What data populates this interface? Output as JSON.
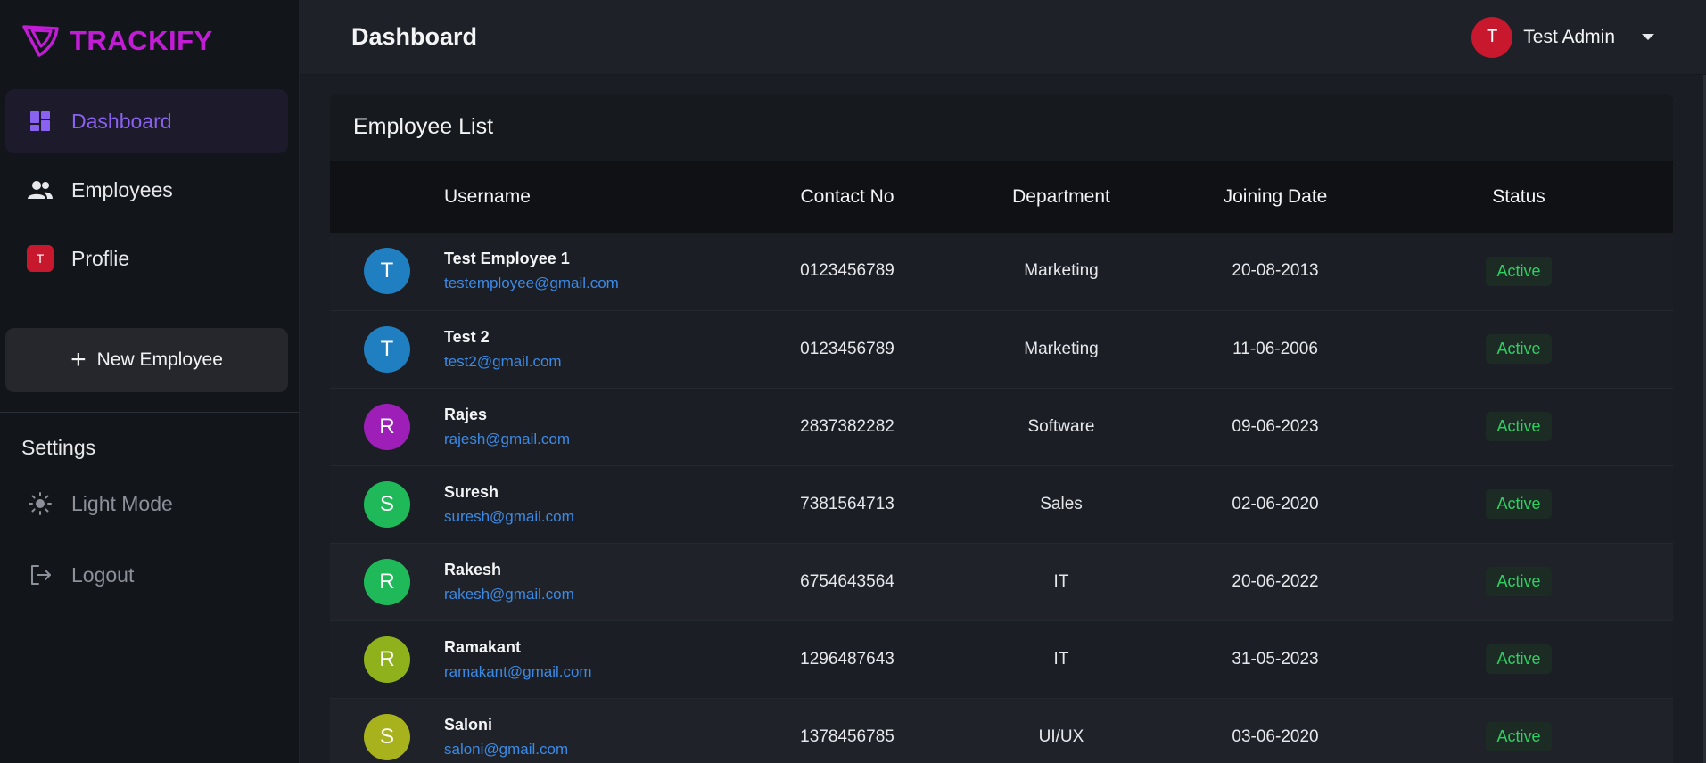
{
  "brand": {
    "name": "TRACKIFY",
    "color": "#c21cd6",
    "logo_icon": "trackify-logo-icon"
  },
  "sidebar": {
    "nav": [
      {
        "label": "Dashboard",
        "icon": "dashboard-icon",
        "active": true
      },
      {
        "label": "Employees",
        "icon": "people-icon",
        "active": false
      },
      {
        "label": "Proflie",
        "icon": "profile-badge-icon",
        "badge": "T",
        "active": false
      }
    ],
    "new_button": {
      "label": "New Employee",
      "icon": "plus-icon"
    },
    "settings": {
      "heading": "Settings",
      "items": [
        {
          "label": "Light Mode",
          "icon": "sun-icon"
        },
        {
          "label": "Logout",
          "icon": "logout-icon"
        }
      ]
    }
  },
  "header": {
    "title": "Dashboard",
    "user": {
      "initial": "T",
      "name": "Test Admin",
      "avatar_color": "#c8182d"
    }
  },
  "employee_list": {
    "title": "Employee List",
    "columns": [
      "Username",
      "Contact No",
      "Department",
      "Joining Date",
      "Status"
    ],
    "rows": [
      {
        "initial": "T",
        "avatar_color": "#1f7fc0",
        "name": "Test Employee 1",
        "email": "testemployee@gmail.com",
        "contact": "0123456789",
        "department": "Marketing",
        "joining": "20-08-2013",
        "status": "Active"
      },
      {
        "initial": "T",
        "avatar_color": "#1f7fc0",
        "name": "Test 2",
        "email": "test2@gmail.com",
        "contact": "0123456789",
        "department": "Marketing",
        "joining": "11-06-2006",
        "status": "Active"
      },
      {
        "initial": "R",
        "avatar_color": "#9d1fb8",
        "name": "Rajes",
        "email": "rajesh@gmail.com",
        "contact": "2837382282",
        "department": "Software",
        "joining": "09-06-2023",
        "status": "Active"
      },
      {
        "initial": "S",
        "avatar_color": "#1fb95a",
        "name": "Suresh",
        "email": "suresh@gmail.com",
        "contact": "7381564713",
        "department": "Sales",
        "joining": "02-06-2020",
        "status": "Active"
      },
      {
        "initial": "R",
        "avatar_color": "#1fb95a",
        "name": "Rakesh",
        "email": "rakesh@gmail.com",
        "contact": "6754643564",
        "department": "IT",
        "joining": "20-06-2022",
        "status": "Active"
      },
      {
        "initial": "R",
        "avatar_color": "#8fb21c",
        "name": "Ramakant",
        "email": "ramakant@gmail.com",
        "contact": "1296487643",
        "department": "IT",
        "joining": "31-05-2023",
        "status": "Active"
      },
      {
        "initial": "S",
        "avatar_color": "#a8b21c",
        "name": "Saloni",
        "email": "saloni@gmail.com",
        "contact": "1378456785",
        "department": "UI/UX",
        "joining": "03-06-2020",
        "status": "Active"
      }
    ]
  }
}
